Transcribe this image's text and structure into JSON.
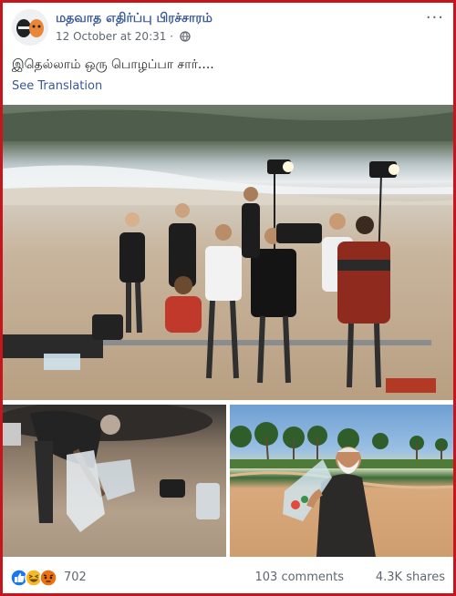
{
  "post": {
    "page_name": "மதவாத எதிர்ப்பு பிரச்சாரம்",
    "timestamp": "12 October at 20:31",
    "separator": "·",
    "privacy_icon": "globe-icon",
    "more_icon": "more-options-icon",
    "text": "இதெல்லாம் ஒரு பொழப்பா சார்....",
    "see_translation": "See Translation"
  },
  "photos": [
    {
      "id": "main",
      "icon": "film-crew-beach-photo"
    },
    {
      "id": "bottom-left",
      "icon": "man-picking-litter-photo"
    },
    {
      "id": "bottom-right",
      "icon": "man-holding-plastic-bag-photo"
    }
  ],
  "footer": {
    "reaction_icons": [
      "like-icon",
      "haha-icon",
      "angry-icon"
    ],
    "reaction_count": "702",
    "comments": "103 comments",
    "shares": "4.3K shares"
  },
  "colors": {
    "frame": "#c4161c",
    "link": "#385898",
    "like": "#1877f2",
    "haha": "#f7b928",
    "angry": "#e9710f"
  }
}
